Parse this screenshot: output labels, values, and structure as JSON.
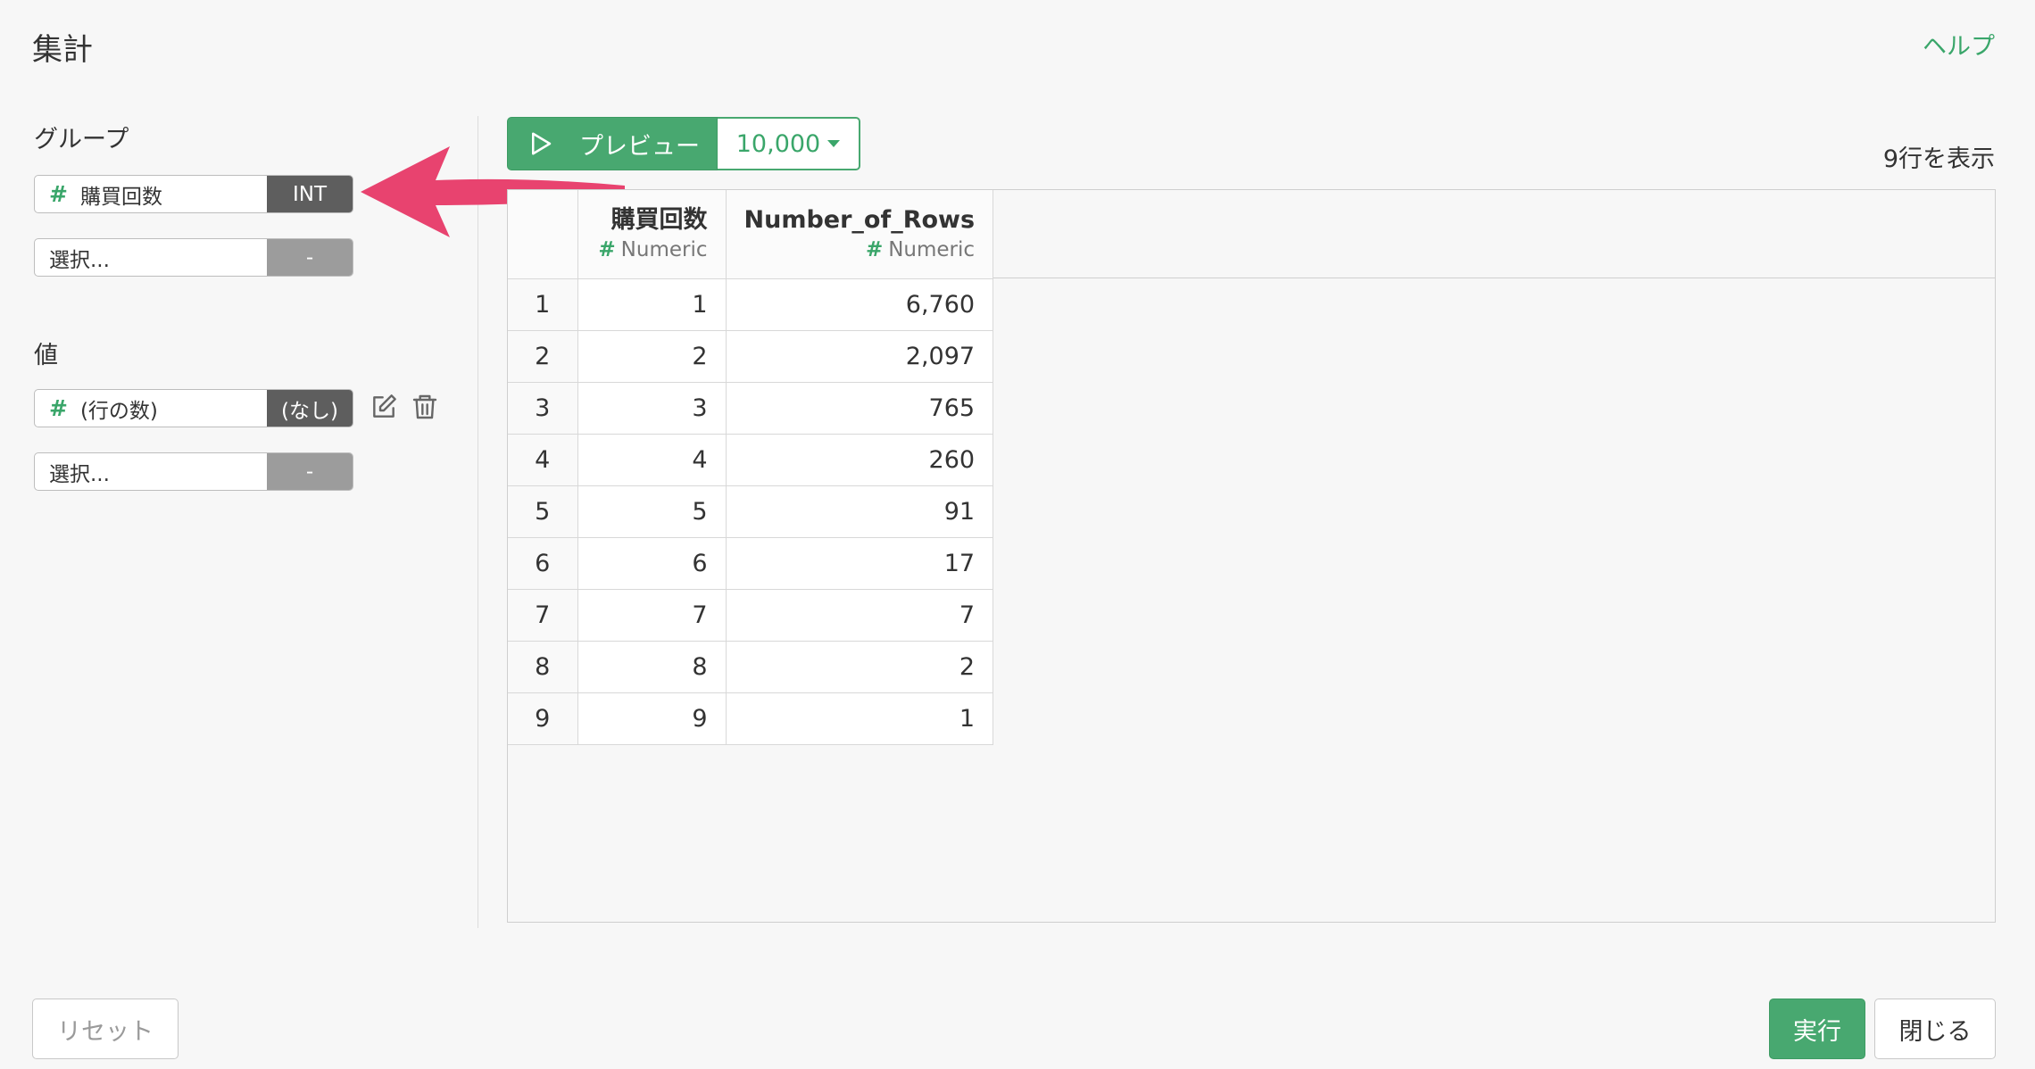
{
  "header": {
    "title": "集計",
    "help_label": "ヘルプ"
  },
  "group_section": {
    "label": "グループ",
    "fields": [
      {
        "name": "購買回数",
        "type": "INT",
        "icon": "hash-icon"
      },
      {
        "name": "選択...",
        "type": "-"
      }
    ]
  },
  "value_section": {
    "label": "値",
    "fields": [
      {
        "name": "(行の数)",
        "type": "(なし)",
        "icon": "hash-icon"
      },
      {
        "name": "選択...",
        "type": "-"
      }
    ]
  },
  "toolbar": {
    "preview_label": "プレビュー",
    "row_limit": "10,000",
    "row_count_text": "9行を表示"
  },
  "table": {
    "columns": [
      {
        "name": "購買回数",
        "type": "Numeric"
      },
      {
        "name": "Number_of_Rows",
        "type": "Numeric"
      }
    ],
    "rows": [
      [
        "1",
        "1",
        "6,760"
      ],
      [
        "2",
        "2",
        "2,097"
      ],
      [
        "3",
        "3",
        "765"
      ],
      [
        "4",
        "4",
        "260"
      ],
      [
        "5",
        "5",
        "91"
      ],
      [
        "6",
        "6",
        "17"
      ],
      [
        "7",
        "7",
        "7"
      ],
      [
        "8",
        "8",
        "2"
      ],
      [
        "9",
        "9",
        "1"
      ]
    ]
  },
  "footer": {
    "reset_label": "リセット",
    "run_label": "実行",
    "close_label": "閉じる"
  },
  "colors": {
    "accent": "#48a870",
    "arrow": "#e8436f",
    "type_badge": "#5e5e5e"
  }
}
